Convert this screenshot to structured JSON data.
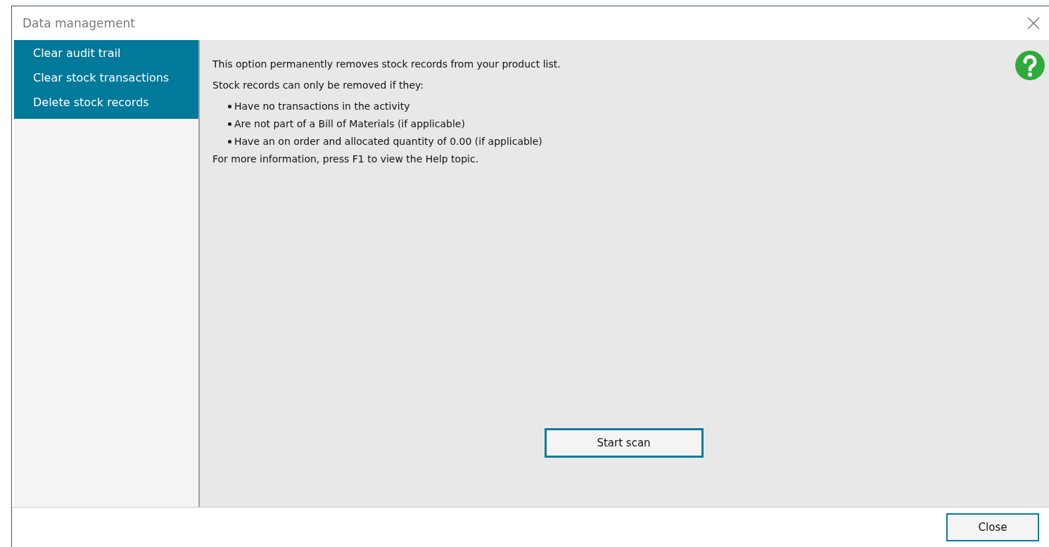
{
  "window": {
    "title": "Data management"
  },
  "sidebar": {
    "items": [
      {
        "label": "Clear audit trail"
      },
      {
        "label": "Clear stock transactions"
      },
      {
        "label": "Delete stock records"
      }
    ]
  },
  "content": {
    "intro": "This option permanently removes stock records from your product list.",
    "condition_heading": "Stock records can only be removed if they:",
    "conditions": [
      "Have no transactions in the activity",
      "Are not part of a Bill of Materials (if applicable)",
      "Have an on order and allocated quantity of 0.00 (if applicable)"
    ],
    "footnote": "For more information, press F1 to view the Help topic.",
    "scan_button": "Start scan"
  },
  "footer": {
    "close_button": "Close"
  }
}
